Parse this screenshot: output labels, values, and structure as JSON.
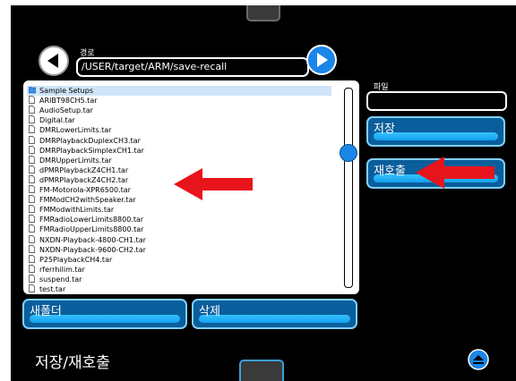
{
  "path": {
    "label": "경로",
    "value": "/USER/target/ARM/save-recall"
  },
  "file": {
    "label": "파일",
    "value": ""
  },
  "files": [
    "Sample Setups",
    "ARIBT98CH5.tar",
    "AudioSetup.tar",
    "Digital.tar",
    "DMRLowerLimits.tar",
    "DMRPlaybackDuplexCH3.tar",
    "DMRPlaybackSimplexCH1.tar",
    "DMRUpperLimits.tar",
    "dPMRPlaybackZ4CH1.tar",
    "dPMRPlaybackZ4CH2.tar",
    "FM-Motorola-XPR6500.tar",
    "FMModCH2withSpeaker.tar",
    "FMModwithLimits.tar",
    "FMRadioLowerLimits8800.tar",
    "FMRadioUpperLimits8800.tar",
    "NXDN-Playback-4800-CH1.tar",
    "NXDN-Playback-9600-CH2.tar",
    "P25PlaybackCH4.tar",
    "rferrhilim.tar",
    "suspend.tar",
    "test.tar"
  ],
  "buttons": {
    "save": "저장",
    "recall": "재호출",
    "new_folder": "새폴더",
    "delete": "삭제"
  },
  "title": "저장/재호출",
  "colors": {
    "accent": "#1a86e8",
    "button": "#12a0ee",
    "arrow": "#e8141c"
  }
}
